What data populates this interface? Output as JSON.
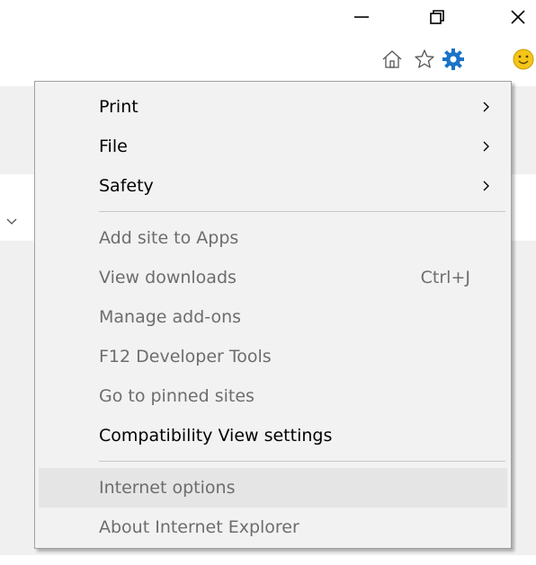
{
  "menu": {
    "items": [
      {
        "label": "Print",
        "submenu": true,
        "enabled": true
      },
      {
        "label": "File",
        "submenu": true,
        "enabled": true
      },
      {
        "label": "Safety",
        "submenu": true,
        "enabled": true
      },
      {
        "label": "Add site to Apps",
        "enabled": false
      },
      {
        "label": "View downloads",
        "shortcut": "Ctrl+J",
        "enabled": false
      },
      {
        "label": "Manage add-ons",
        "enabled": false
      },
      {
        "label": "F12 Developer Tools",
        "enabled": false
      },
      {
        "label": "Go to pinned sites",
        "enabled": false
      },
      {
        "label": "Compatibility View settings",
        "enabled": true
      },
      {
        "label": "Internet options",
        "enabled": false,
        "highlighted": true
      },
      {
        "label": "About Internet Explorer",
        "enabled": false
      }
    ]
  },
  "icons": {
    "window_controls": [
      "minimize-icon",
      "restore-icon",
      "close-icon"
    ],
    "toolbar": [
      "home-icon",
      "favorites-star-icon",
      "tools-gear-icon",
      "feedback-smiley-icon"
    ],
    "menu_arrow": "chevron-right-icon"
  },
  "colors": {
    "menu_background": "#f2f2f2",
    "menu_border": "#a0a0a0",
    "highlight": "#e5e5e5",
    "disabled_text": "#6d6d6d",
    "gear": "#1a73c8",
    "smiley": "#f5c518"
  }
}
